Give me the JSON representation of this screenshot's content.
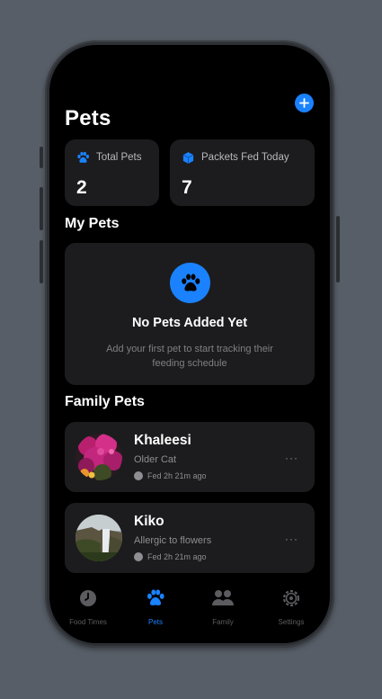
{
  "header": {
    "title": "Pets"
  },
  "stats": [
    {
      "label": "Total Pets",
      "value": "2",
      "icon": "paw-icon"
    },
    {
      "label": "Packets Fed Today",
      "value": "7",
      "icon": "cube-icon"
    }
  ],
  "my_pets": {
    "heading": "My Pets",
    "empty_title": "No Pets Added Yet",
    "empty_desc": "Add your first pet to start tracking their feeding schedule"
  },
  "family_pets": {
    "heading": "Family Pets",
    "items": [
      {
        "name": "Khaleesi",
        "desc": "Older Cat",
        "fed": "Fed 2h 21m ago",
        "more": "···"
      },
      {
        "name": "Kiko",
        "desc": "Allergic to flowers",
        "fed": "Fed 2h 21m ago",
        "more": "···"
      }
    ]
  },
  "tabs": [
    {
      "label": "Food Times",
      "icon": "clock-icon",
      "active": false
    },
    {
      "label": "Pets",
      "icon": "paw-icon",
      "active": true
    },
    {
      "label": "Family",
      "icon": "people-icon",
      "active": false
    },
    {
      "label": "Settings",
      "icon": "gear-icon",
      "active": false
    }
  ],
  "colors": {
    "accent": "#1a82ff",
    "card": "#1c1c1e",
    "background": "#000000"
  }
}
